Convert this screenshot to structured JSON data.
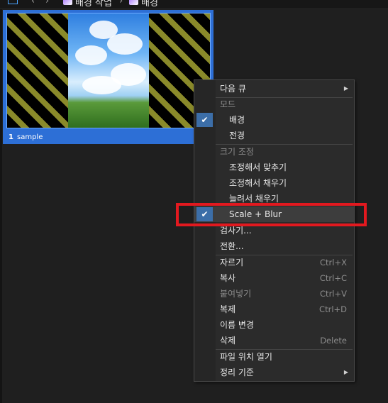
{
  "topbar": {
    "nav_back": "‹",
    "nav_forward": "›",
    "crumb1": "배경 작업",
    "crumb_sep": "›",
    "crumb2": "배경"
  },
  "tile": {
    "number": "1",
    "name": "sample"
  },
  "menu": {
    "next_cue": "다음 큐",
    "mode_header": "모드",
    "mode_background": "배경",
    "mode_foreground": "전경",
    "resize_header": "크기 조정",
    "resize_fit": "조정해서 맞추기",
    "resize_fill": "조정해서 채우기",
    "resize_stretch": "늘려서 채우기",
    "resize_scale_blur": "Scale + Blur",
    "inspector": "검사기...",
    "transition": "전환...",
    "cut": "자르기",
    "cut_shortcut": "Ctrl+X",
    "copy": "복사",
    "copy_shortcut": "Ctrl+C",
    "paste": "붙여넣기",
    "paste_shortcut": "Ctrl+V",
    "duplicate": "복제",
    "duplicate_shortcut": "Ctrl+D",
    "rename": "이름 변경",
    "delete": "삭제",
    "delete_shortcut": "Delete",
    "open_file_location": "파일 위치 열기",
    "sort_by": "정리 기준",
    "check_glyph": "✔",
    "submenu_glyph": "▶"
  },
  "colors": {
    "accent": "#2d6fd6",
    "check_bg": "#3c6ea8",
    "highlight": "#e2191f"
  }
}
